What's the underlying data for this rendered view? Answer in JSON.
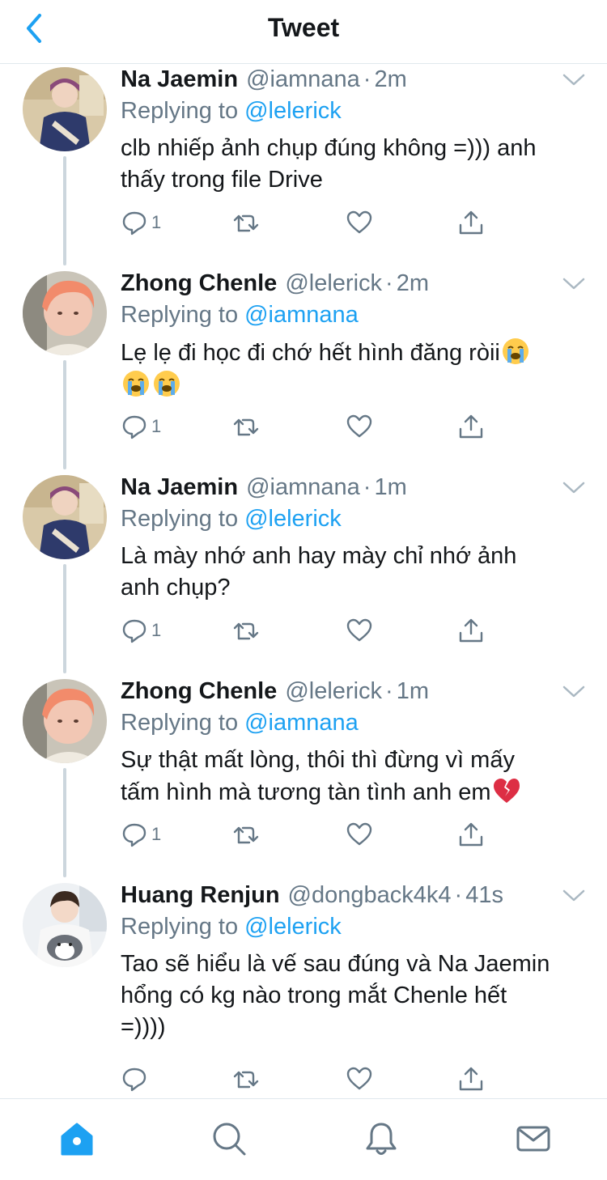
{
  "header": {
    "title": "Tweet",
    "back_icon": "chevron-left-icon"
  },
  "colors": {
    "accent": "#1da1f2",
    "secondary_text": "#657786",
    "primary_text": "#14171a",
    "heart_red": "#e0245e"
  },
  "tweets": [
    {
      "name": "Na Jaemin",
      "handle": "@iamnana",
      "separator": "·",
      "time": "2m",
      "replying_label": "Replying to",
      "replying_to": "@lelerick",
      "text": "clb nhiếp ảnh chụp đúng không =))) anh\nthấy trong file Drive",
      "reply_count": "1"
    },
    {
      "name": "Zhong Chenle",
      "handle": "@lelerick",
      "separator": "·",
      "time": "2m",
      "replying_label": "Replying to",
      "replying_to": "@iamnana",
      "text": "Lẹ lẹ đi học đi chớ hết hình đăng ròii",
      "text_emojis": [
        "loudly-crying-face",
        "loudly-crying-face",
        "loudly-crying-face"
      ],
      "reply_count": "1"
    },
    {
      "name": "Na Jaemin",
      "handle": "@iamnana",
      "separator": "·",
      "time": "1m",
      "replying_label": "Replying to",
      "replying_to": "@lelerick",
      "text": "Là mày nhớ anh hay mày chỉ nhớ ảnh\nanh chụp?",
      "reply_count": "1"
    },
    {
      "name": "Zhong Chenle",
      "handle": "@lelerick",
      "separator": "·",
      "time": "1m",
      "replying_label": "Replying to",
      "replying_to": "@iamnana",
      "text_line1": "Sự thật mất lòng, thôi thì đừng vì mấy",
      "text_line2": "tấm hình mà tương tàn tình anh em",
      "text_emoji": "broken-heart",
      "reply_count": "1"
    },
    {
      "name": "Huang Renjun",
      "handle": "@dongback4k4",
      "separator": "·",
      "time": "41s",
      "replying_label": "Replying to",
      "replying_to": "@lelerick",
      "text": "Tao sẽ hiểu là vế sau đúng và Na Jaemin\nhổng có kg nào trong mắt Chenle hết\n=))))",
      "reply_count": ""
    }
  ],
  "tabbar": {
    "items": [
      "home-icon",
      "search-icon",
      "notifications-icon",
      "messages-icon"
    ],
    "active": "home-icon"
  }
}
